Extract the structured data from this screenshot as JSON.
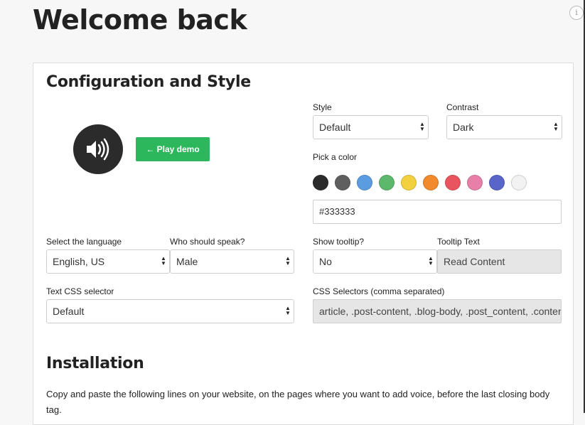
{
  "page": {
    "title": "Welcome back",
    "info_glyph": "i"
  },
  "config": {
    "heading": "Configuration and Style",
    "play_button": "← Play demo",
    "style": {
      "label": "Style",
      "value": "Default"
    },
    "contrast": {
      "label": "Contrast",
      "value": "Dark"
    },
    "color_picker": {
      "label": "Pick a color",
      "swatches": [
        "#2b2b2b",
        "#5f5f5f",
        "#5b9be0",
        "#5cb86b",
        "#f3d03e",
        "#f08a2c",
        "#e9555f",
        "#e77fa8",
        "#5965c9",
        "#f2f2f2"
      ],
      "value": "#333333"
    },
    "language": {
      "label": "Select the language",
      "value": "English, US"
    },
    "speaker": {
      "label": "Who should speak?",
      "value": "Male"
    },
    "tooltip": {
      "label": "Show tooltip?",
      "value": "No"
    },
    "tooltip_text": {
      "label": "Tooltip Text",
      "value": "Read Content"
    },
    "text_css": {
      "label": "Text CSS selector",
      "value": "Default"
    },
    "css_selectors": {
      "label": "CSS Selectors (comma separated)",
      "value": "article, .post-content, .blog-body, .post_content, .content, .entry-content"
    }
  },
  "installation": {
    "heading": "Installation",
    "text": "Copy and paste the following lines on your website, on the pages where you want to add voice, before the last closing body tag."
  }
}
